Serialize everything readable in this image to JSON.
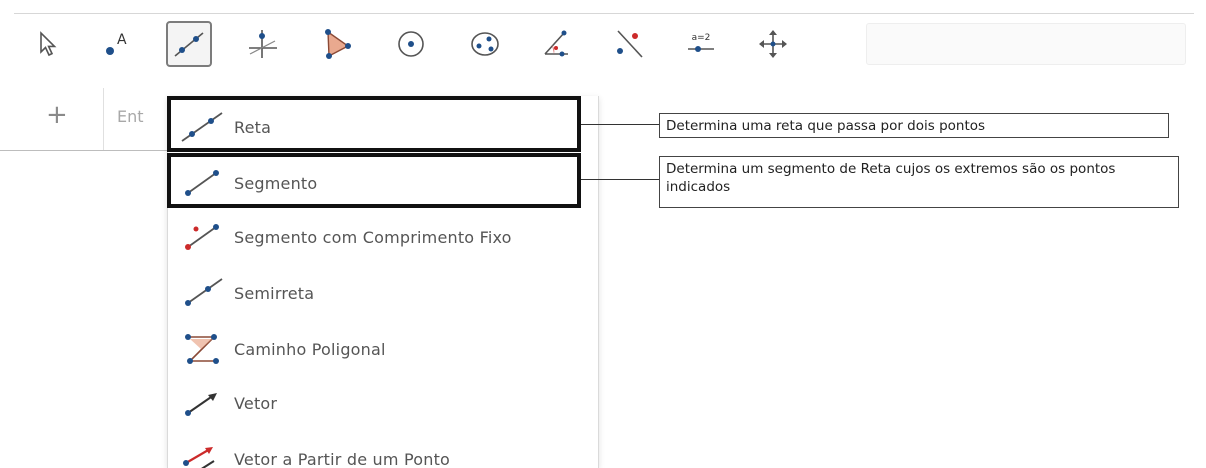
{
  "toolbar": {
    "tools": [
      {
        "name": "move-tool",
        "icon": "pointer-arrow-icon"
      },
      {
        "name": "point-tool",
        "icon": "point-a-icon"
      },
      {
        "name": "line-tool",
        "icon": "line-through-points-icon",
        "active": true
      },
      {
        "name": "perpendicular-tool",
        "icon": "perpendicular-line-icon"
      },
      {
        "name": "polygon-tool",
        "icon": "polygon-icon"
      },
      {
        "name": "circle-tool",
        "icon": "circle-center-icon"
      },
      {
        "name": "conic-tool",
        "icon": "conic-ellipse-icon"
      },
      {
        "name": "angle-tool",
        "icon": "angle-icon"
      },
      {
        "name": "reflect-tool",
        "icon": "reflect-point-icon"
      },
      {
        "name": "slider-tool",
        "icon": "slider-icon",
        "label": "a=2"
      },
      {
        "name": "move-graphics-tool",
        "icon": "move-cross-icon"
      }
    ]
  },
  "algebra": {
    "plus_label": "+",
    "input_placeholder": "Ent"
  },
  "menu": {
    "items": [
      {
        "label": "Reta",
        "icon": "line-icon"
      },
      {
        "label": "Segmento",
        "icon": "segment-icon"
      },
      {
        "label": "Segmento com Comprimento Fixo",
        "icon": "segment-fixed-length-icon"
      },
      {
        "label": "Semirreta",
        "icon": "ray-icon"
      },
      {
        "label": "Caminho Poligonal",
        "icon": "polyline-icon"
      },
      {
        "label": "Vetor",
        "icon": "vector-icon"
      },
      {
        "label": "Vetor a Partir de um Ponto",
        "icon": "vector-from-point-icon"
      }
    ]
  },
  "callouts": {
    "reta": "Determina uma reta que passa por dois pontos",
    "segmento": "Determina um segmento de Reta cujos os extremos são os pontos indicados"
  },
  "colors": {
    "point_blue": "#1f4f8a",
    "point_red": "#cc2a2a",
    "highlight_border": "#111111"
  }
}
